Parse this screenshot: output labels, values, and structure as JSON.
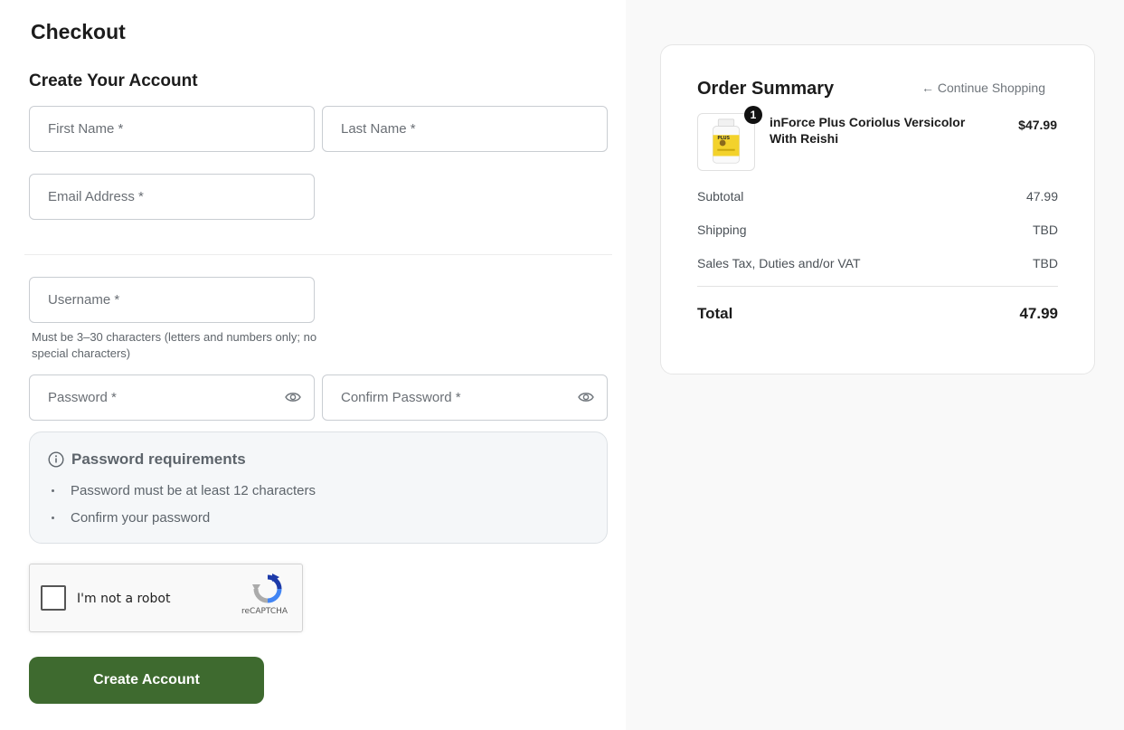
{
  "page": {
    "title": "Checkout"
  },
  "account": {
    "section_title": "Create Your Account",
    "first_name_placeholder": "First Name *",
    "last_name_placeholder": "Last Name *",
    "email_placeholder": "Email Address *",
    "username_placeholder": "Username *",
    "username_hint": "Must be 3–30 characters (letters and numbers only; no special characters)",
    "password_placeholder": "Password *",
    "confirm_password_placeholder": "Confirm Password *"
  },
  "requirements": {
    "title": "Password requirements",
    "items": [
      "Password must be at least 12 characters",
      "Confirm your password"
    ]
  },
  "captcha": {
    "label": "I'm not a robot",
    "brand": "reCAPTCHA"
  },
  "submit": {
    "label": "Create Account"
  },
  "summary": {
    "title": "Order Summary",
    "continue_label": "← Continue Shopping",
    "item": {
      "name": "inForce Plus Coriolus Versicolor With Reishi",
      "price": "$47.99",
      "quantity": "1",
      "thumb_label": "PLUS"
    },
    "subtotal_label": "Subtotal",
    "subtotal_value": "47.99",
    "shipping_label": "Shipping",
    "shipping_value": "TBD",
    "tax_label": "Sales Tax, Duties and/or VAT",
    "tax_value": "TBD",
    "total_label": "Total",
    "total_value": "47.99"
  },
  "colors": {
    "primary": "#3e6a2f",
    "panel_bg": "#f9f9f9",
    "req_bg": "#f5f7f9"
  }
}
